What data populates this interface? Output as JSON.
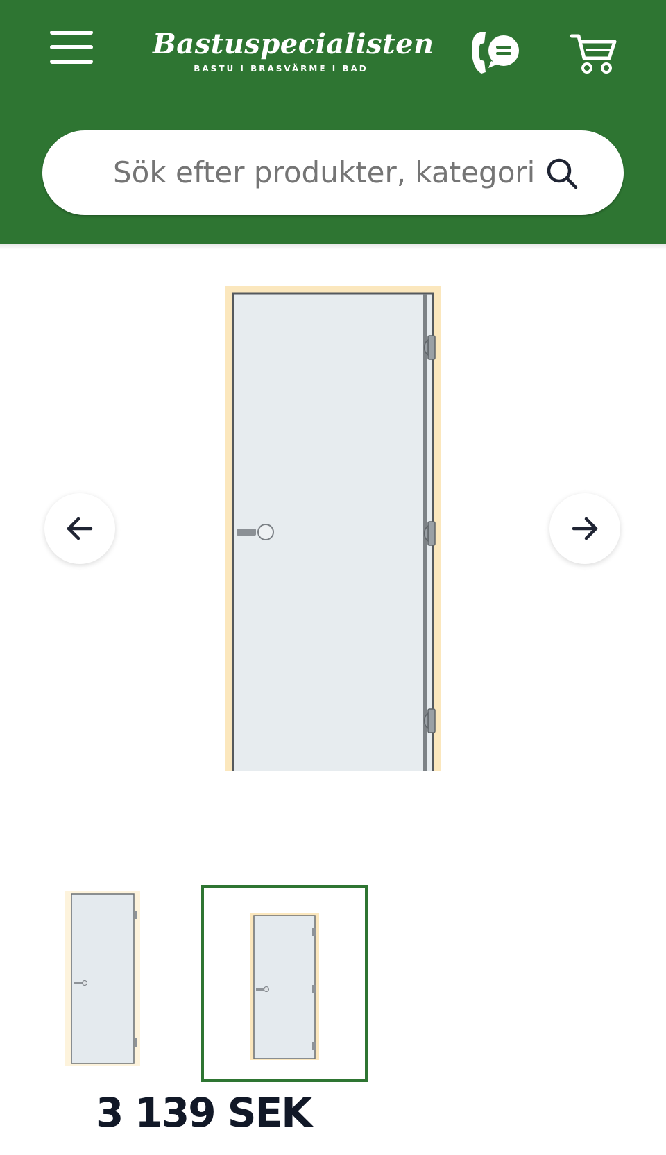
{
  "header": {
    "logo_name": "Bastuspecialisten",
    "logo_tagline": "BASTU I BRASVÄRME I BAD",
    "brand_color": "#2e7532"
  },
  "search": {
    "placeholder": "Sök efter produkter, kategori"
  },
  "icons": {
    "menu": "hamburger-menu-icon",
    "contact": "phone-chat-icon",
    "cart": "shopping-cart-icon",
    "search": "search-icon",
    "prev": "arrow-left-icon",
    "next": "arrow-right-icon"
  },
  "gallery": {
    "main_image": "glass-sauna-door",
    "thumbnails": [
      {
        "image": "glass-sauna-door",
        "selected": false
      },
      {
        "image": "glass-sauna-door",
        "selected": true
      }
    ]
  },
  "product": {
    "price": "3 139 SEK"
  }
}
